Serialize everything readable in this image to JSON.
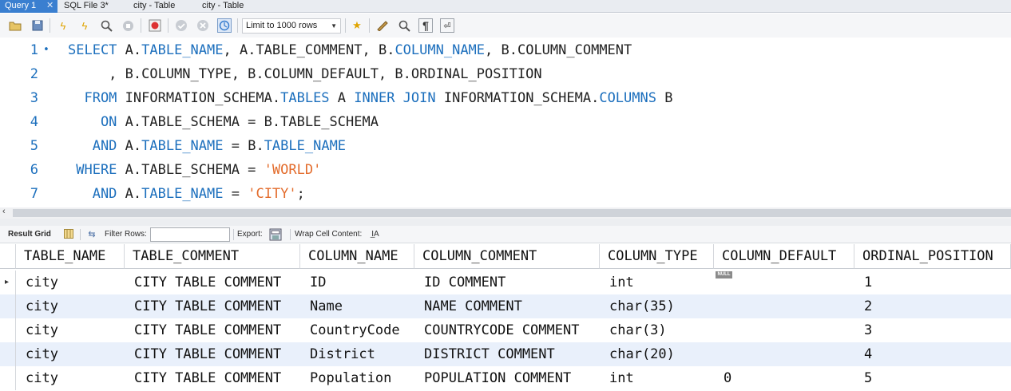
{
  "tabs": [
    {
      "label": "Query 1",
      "active": true
    },
    {
      "label": "SQL File 3*"
    },
    {
      "label": "city - Table"
    },
    {
      "label": "city - Table"
    }
  ],
  "toolbar": {
    "limit_select": "Limit to 1000 rows",
    "icons": [
      "open-folder-icon",
      "save-icon",
      "execute-icon",
      "execute-statement-icon",
      "explain-icon",
      "stop-icon",
      "toggle-error-stop-icon",
      "commit-icon",
      "rollback-icon",
      "autocommit-icon",
      "limit-dropdown",
      "add-snippet-icon",
      "beautify-icon",
      "find-icon",
      "invisible-chars-icon",
      "wrap-icon"
    ]
  },
  "editor": {
    "lines": [
      {
        "num": "1",
        "marker": "•",
        "tokens": [
          {
            "t": "SELECT",
            "c": "kw"
          },
          {
            "t": " A.",
            "c": ""
          },
          {
            "t": "TABLE_NAME",
            "c": "id"
          },
          {
            "t": ", A.TABLE_COMMENT, B.",
            "c": ""
          },
          {
            "t": "COLUMN_NAME",
            "c": "id"
          },
          {
            "t": ", B.COLUMN_COMMENT",
            "c": ""
          }
        ]
      },
      {
        "num": "2",
        "marker": "",
        "tokens": [
          {
            "t": "     , B.COLUMN_TYPE, B.COLUMN_DEFAULT, B.ORDINAL_POSITION",
            "c": ""
          }
        ]
      },
      {
        "num": "3",
        "marker": "",
        "tokens": [
          {
            "t": "  FROM",
            "c": "kw"
          },
          {
            "t": " INFORMATION_SCHEMA.",
            "c": ""
          },
          {
            "t": "TABLES",
            "c": "id"
          },
          {
            "t": " A ",
            "c": ""
          },
          {
            "t": "INNER JOIN",
            "c": "kw"
          },
          {
            "t": " INFORMATION_SCHEMA.",
            "c": ""
          },
          {
            "t": "COLUMNS",
            "c": "id"
          },
          {
            "t": " B",
            "c": ""
          }
        ]
      },
      {
        "num": "4",
        "marker": "",
        "tokens": [
          {
            "t": "    ON",
            "c": "kw"
          },
          {
            "t": " A.TABLE_SCHEMA = B.TABLE_SCHEMA",
            "c": ""
          }
        ]
      },
      {
        "num": "5",
        "marker": "",
        "tokens": [
          {
            "t": "   AND",
            "c": "kw"
          },
          {
            "t": " A.",
            "c": ""
          },
          {
            "t": "TABLE_NAME",
            "c": "id"
          },
          {
            "t": " = B.",
            "c": ""
          },
          {
            "t": "TABLE_NAME",
            "c": "id"
          }
        ]
      },
      {
        "num": "6",
        "marker": "",
        "tokens": [
          {
            "t": " WHERE",
            "c": "kw"
          },
          {
            "t": " A.TABLE_SCHEMA = ",
            "c": ""
          },
          {
            "t": "'WORLD'",
            "c": "str"
          }
        ]
      },
      {
        "num": "7",
        "marker": "",
        "tokens": [
          {
            "t": "   AND",
            "c": "kw"
          },
          {
            "t": " A.",
            "c": ""
          },
          {
            "t": "TABLE_NAME",
            "c": "id"
          },
          {
            "t": " = ",
            "c": ""
          },
          {
            "t": "'CITY'",
            "c": "str"
          },
          {
            "t": ";",
            "c": ""
          }
        ]
      }
    ]
  },
  "results_toolbar": {
    "result_grid_label": "Result Grid",
    "filter_label": "Filter Rows:",
    "filter_value": "",
    "export_label": "Export:",
    "wrap_label": "Wrap Cell Content:"
  },
  "grid": {
    "columns": [
      "TABLE_NAME",
      "TABLE_COMMENT",
      "COLUMN_NAME",
      "COLUMN_COMMENT",
      "COLUMN_TYPE",
      "COLUMN_DEFAULT",
      "ORDINAL_POSITION"
    ],
    "null_badge": "NULL",
    "rows": [
      [
        "city",
        "CITY TABLE COMMENT",
        "ID",
        "ID COMMENT",
        "int",
        "",
        "1"
      ],
      [
        "city",
        "CITY TABLE COMMENT",
        "Name",
        "NAME COMMENT",
        "char(35)",
        "",
        "2"
      ],
      [
        "city",
        "CITY TABLE COMMENT",
        "CountryCode",
        "COUNTRYCODE COMMENT",
        "char(3)",
        "",
        "3"
      ],
      [
        "city",
        "CITY TABLE COMMENT",
        "District",
        "DISTRICT COMMENT",
        "char(20)",
        "",
        "4"
      ],
      [
        "city",
        "CITY TABLE COMMENT",
        "Population",
        "POPULATION COMMENT",
        "int",
        "0",
        "5"
      ]
    ]
  }
}
